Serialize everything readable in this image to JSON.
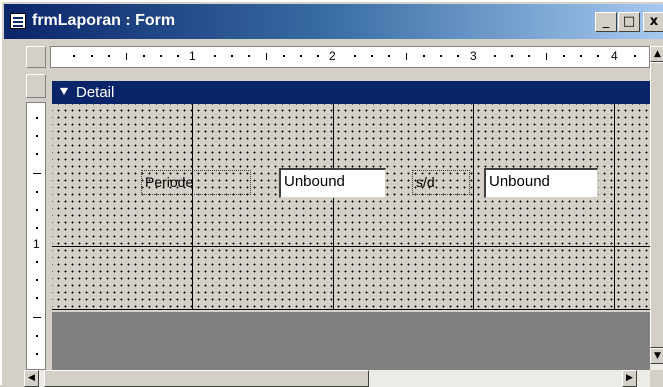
{
  "window": {
    "title": "frmLaporan : Form",
    "icon": "form-icon",
    "buttons": {
      "minimize": "_",
      "maximize": "□",
      "close": "x"
    }
  },
  "ruler": {
    "horizontal_numbers": [
      "1",
      "2",
      "3",
      "4"
    ],
    "vertical_numbers": [
      "1"
    ]
  },
  "section": {
    "label": "Detail",
    "icon": "section-arrow-icon"
  },
  "controls": {
    "periode_label": "Periode",
    "start_textbox": "Unbound",
    "sd_label": "s/d",
    "end_textbox": "Unbound"
  },
  "colors": {
    "titlebar": "#0a246a",
    "section_bar": "#0a246a",
    "face": "#d4d0c8"
  }
}
